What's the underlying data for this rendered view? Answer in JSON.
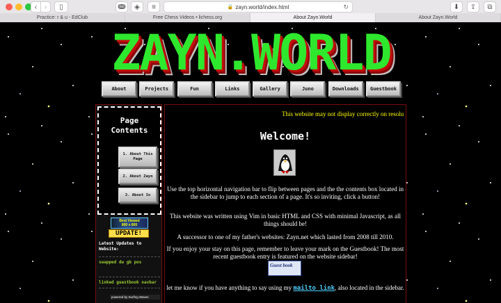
{
  "browser": {
    "url": "zayn.world/index.html",
    "tabs": [
      {
        "label": "Practice: r & u - EdClub",
        "active": false
      },
      {
        "label": "Free Chess Videos • lichess.org",
        "active": false
      },
      {
        "label": "About Zayn.World",
        "active": true
      },
      {
        "label": "About Zayn.World",
        "active": false
      }
    ]
  },
  "site": {
    "logo": "ZAYN.WORLD",
    "nav": [
      "About",
      "Projects",
      "Fun",
      "Links",
      "Gallery",
      "Juno",
      "Downloads",
      "Guestbook"
    ]
  },
  "sidebar": {
    "contents_title": "Page\nContents",
    "contents": [
      "1. About This Page",
      "2. About Zayn",
      "3. About Io"
    ],
    "badge_viewed": "Best Viewed\n800 x 600",
    "badge_update": "UPDATE!",
    "updates_title": "Latest Updates to Website:",
    "updates": [
      "swapped dw gb pos",
      "linked guestbook navbar"
    ],
    "powered_by": "powered by Surfing Waves"
  },
  "main": {
    "marquee": "This website may not display correctly on resolu",
    "heading": "Welcome!",
    "p1": "Use the top horizontal navigation bar to flip between pages and the the contents box located in the sidebar to jump to each section of a page. It's so inviting, click a button!",
    "p2": "This website was written using Vim in basic HTML and CSS with minimal Javascript, as all things should be!",
    "p3": "A successor to one of my father's websites: Zayn.net which lasted from 2008 till 2010.",
    "p4": "If you enjoy your stay on this page, remember to leave your mark on the Guestbook! The most recent guestbook entry is featured on the website sidebar!",
    "guestbook_badge": "Guest book",
    "p5_a": "let me know if you have anything to say using my",
    "mailto": "mailto link",
    "p5_b": ", also located in the sidebar."
  }
}
